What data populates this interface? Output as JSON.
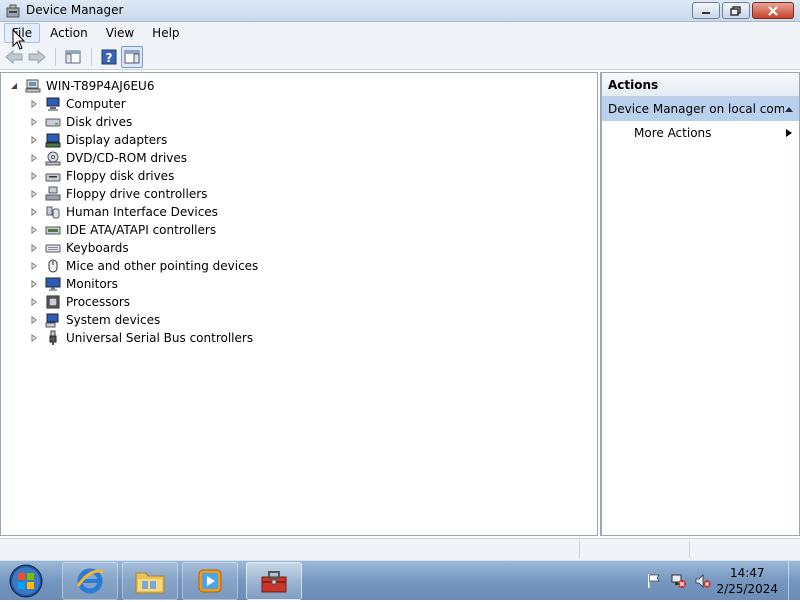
{
  "window": {
    "title": "Device Manager"
  },
  "menu": {
    "file": "File",
    "action": "Action",
    "view": "View",
    "help": "Help"
  },
  "tree": {
    "root": "WIN-T89P4AJ6EU6",
    "items": [
      {
        "label": "Computer",
        "icon": "computer-icon"
      },
      {
        "label": "Disk drives",
        "icon": "disk-drive-icon"
      },
      {
        "label": "Display adapters",
        "icon": "display-adapter-icon"
      },
      {
        "label": "DVD/CD-ROM drives",
        "icon": "dvd-drive-icon"
      },
      {
        "label": "Floppy disk drives",
        "icon": "floppy-drive-icon"
      },
      {
        "label": "Floppy drive controllers",
        "icon": "floppy-controller-icon"
      },
      {
        "label": "Human Interface Devices",
        "icon": "hid-icon"
      },
      {
        "label": "IDE ATA/ATAPI controllers",
        "icon": "ide-controller-icon"
      },
      {
        "label": "Keyboards",
        "icon": "keyboard-icon"
      },
      {
        "label": "Mice and other pointing devices",
        "icon": "mouse-icon"
      },
      {
        "label": "Monitors",
        "icon": "monitor-icon"
      },
      {
        "label": "Processors",
        "icon": "processor-icon"
      },
      {
        "label": "System devices",
        "icon": "system-device-icon"
      },
      {
        "label": "Universal Serial Bus controllers",
        "icon": "usb-icon"
      }
    ]
  },
  "actions": {
    "header": "Actions",
    "group": "Device Manager on local com...",
    "more": "More Actions"
  },
  "taskbar": {
    "apps": [
      "internet-explorer",
      "windows-explorer",
      "media-player",
      "device-manager"
    ],
    "clock": {
      "time": "14:47",
      "date": "2/25/2024"
    }
  },
  "colors": {
    "selection": "#b9d1ec",
    "taskbar": "#7597c0",
    "close": "#c7432a"
  }
}
